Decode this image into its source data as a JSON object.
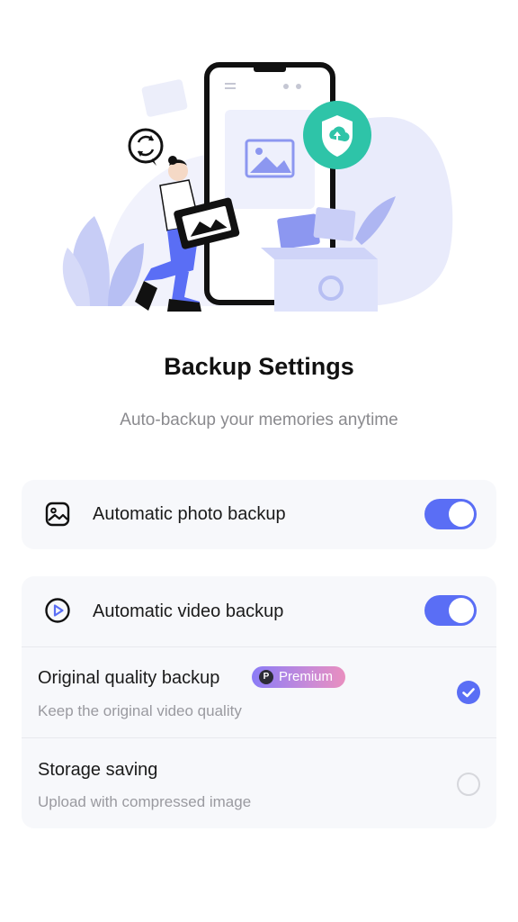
{
  "header": {
    "title": "Backup Settings",
    "subtitle": "Auto-backup your memories anytime"
  },
  "settings": {
    "photo_backup": {
      "label": "Automatic photo backup",
      "enabled": true,
      "icon": "photo-icon"
    },
    "video_backup": {
      "label": "Automatic video backup",
      "enabled": true,
      "icon": "play-circle-icon"
    },
    "options": [
      {
        "title": "Original quality backup",
        "badge": "Premium",
        "badge_letter": "P",
        "description": "Keep the original video quality",
        "selected": true
      },
      {
        "title": "Storage saving",
        "description": "Upload with compressed image",
        "selected": false
      }
    ]
  },
  "colors": {
    "accent": "#5a6ef5",
    "hero_green": "#2ec4a8",
    "hero_lavender": "#e3e6fb"
  }
}
